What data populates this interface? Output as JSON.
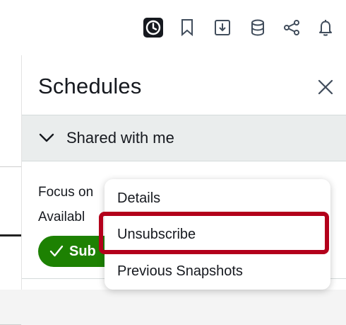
{
  "toolbar": {
    "icons": [
      "clock-icon",
      "bookmark-icon",
      "download-icon",
      "database-icon",
      "share-icon",
      "bell-icon"
    ],
    "active_icon": "clock-icon"
  },
  "panel": {
    "title": "Schedules",
    "section_label": "Shared with me",
    "item": {
      "line1": "Focus on",
      "line2": "Availabl",
      "button_label": "Sub"
    }
  },
  "context_menu": {
    "items": [
      "Details",
      "Unsubscribe",
      "Previous Snapshots"
    ],
    "highlighted_item": "Unsubscribe"
  },
  "colors": {
    "highlight_border": "#b3001b",
    "subscribed_button": "#1d8102",
    "section_background": "#eaeded"
  }
}
